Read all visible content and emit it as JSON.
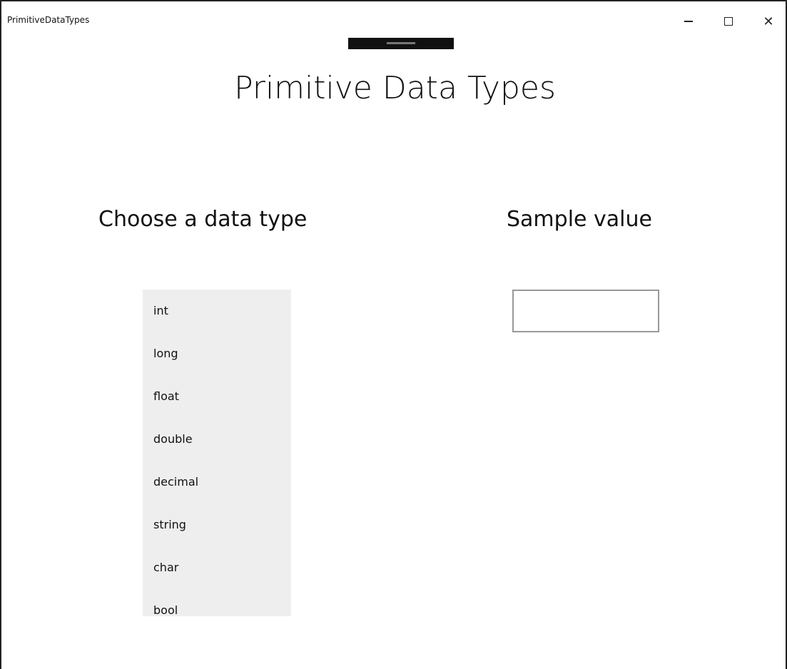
{
  "window": {
    "app_title": "PrimitiveDataTypes",
    "minimize_glyph": "−",
    "maximize_glyph": "□",
    "close_glyph": "✕"
  },
  "page": {
    "title": "Primitive Data Types",
    "choose_label": "Choose a data type",
    "sample_label": "Sample value",
    "sample_value": ""
  },
  "data_types": [
    "int",
    "long",
    "float",
    "double",
    "decimal",
    "string",
    "char",
    "bool"
  ],
  "colors": {
    "list_background": "#eeeeee",
    "textbox_border": "#999999",
    "drag_handle": "#111111"
  },
  "icons": {
    "minimize": "minimize-icon",
    "maximize": "maximize-icon",
    "close": "close-icon"
  }
}
